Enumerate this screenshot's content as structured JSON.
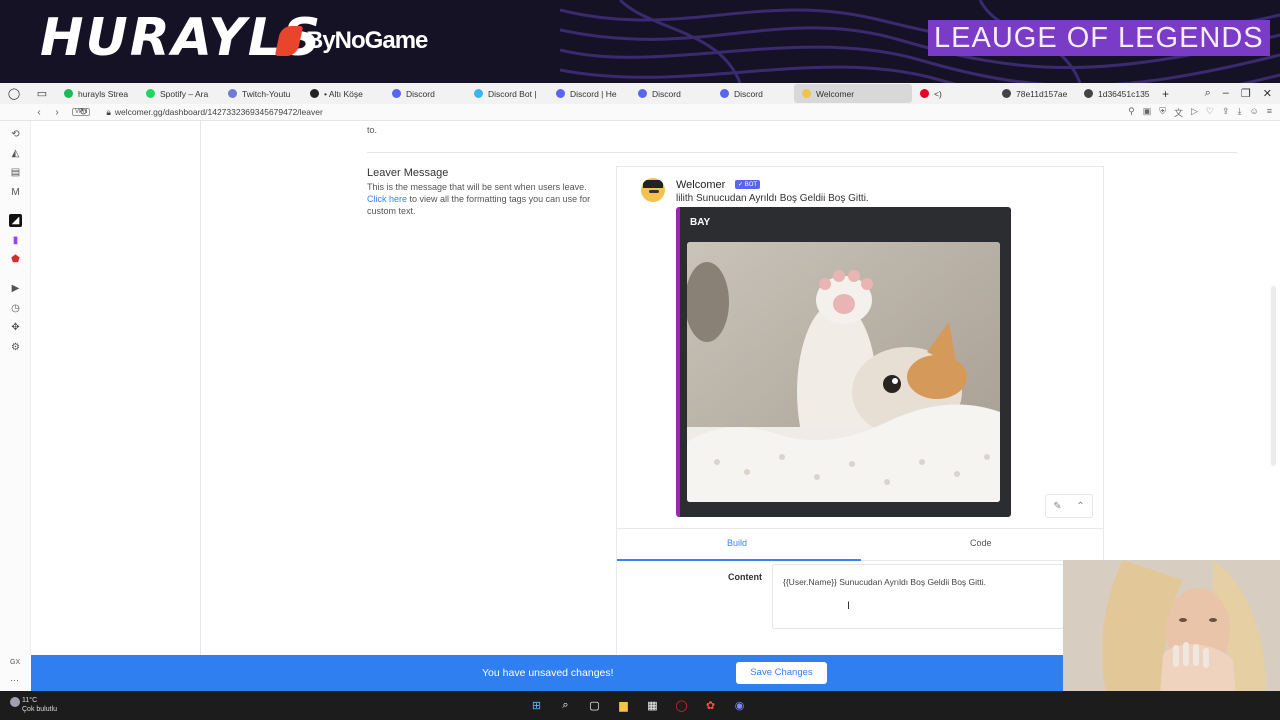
{
  "banner": {
    "streamer_logo": "HURAYLS",
    "sponsor": "ByNoGame",
    "game_title": "LEAUGE OF LEGENDS"
  },
  "browser": {
    "tabs": [
      {
        "label": "hurayls Strea",
        "color": "#1db954",
        "icon": "kick-icon"
      },
      {
        "label": "Spotify – Ara",
        "color": "#1ed760",
        "icon": "spotify-icon"
      },
      {
        "label": "Twitch-Youtu",
        "color": "#6b7bd6",
        "icon": "app-icon"
      },
      {
        "label": "• Altı Köşe",
        "color": "#222222",
        "icon": "app-icon"
      },
      {
        "label": "Discord",
        "color": "#5865f2",
        "icon": "discord-icon"
      },
      {
        "label": "Discord Bot |",
        "color": "#3ab4f2",
        "icon": "discord-bot-icon"
      },
      {
        "label": "Discord | He",
        "color": "#5865f2",
        "icon": "discord-icon"
      },
      {
        "label": "Discord",
        "color": "#5865f2",
        "icon": "discord-icon"
      },
      {
        "label": "Discord",
        "color": "#5865f2",
        "icon": "discord-icon"
      },
      {
        "label": "Welcomer",
        "color": "#f2c14e",
        "icon": "welcomer-icon",
        "active": true
      },
      {
        "label": "<)",
        "color": "#e60023",
        "icon": "pinterest-icon"
      },
      {
        "label": "78e11d157ae",
        "color": "#444444",
        "icon": "file-icon"
      },
      {
        "label": "1d36451c135",
        "color": "#444444",
        "icon": "file-icon"
      }
    ],
    "vpn_label": "VPN",
    "url": "welcomer.gg/dashboard/1427332369345679472/leaver"
  },
  "page": {
    "top_fragment": "to.",
    "leaver": {
      "title": "Leaver Message",
      "desc_before": "This is the message that will be sent when users leave.",
      "link": "Click here",
      "desc_after": "to view all the formatting tags you can use for custom text."
    },
    "preview": {
      "bot_name": "Welcomer",
      "bot_badge": "✓ BOT",
      "message": "lilith Sunucudan Ayrıldı Boş Geldii Boş Gitti.",
      "embed_title": "BAY"
    },
    "tabs": {
      "build": "Build",
      "code": "Code"
    },
    "content_label": "Content",
    "content_value": "{{User.Name}} Sunucudan Ayrıldı Boş Geldii Boş Gitti."
  },
  "savebar": {
    "message": "You have unsaved changes!",
    "button": "Save Changes"
  },
  "rail_bottom": {
    "gx": "GX",
    "more": "···"
  },
  "taskbar": {
    "temperature": "11°C",
    "weather": "Çok bulutlu"
  }
}
